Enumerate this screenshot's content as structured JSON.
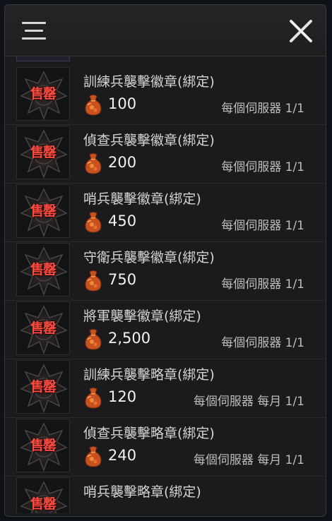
{
  "header": {
    "menu_icon": "menu-icon",
    "close_icon": "close-icon"
  },
  "colors": {
    "panel_bg": "#1b1b1d",
    "badge_label": "#ff4a40",
    "coin": "#e0622a",
    "text_main": "#d4d4d4",
    "text_sub": "#bdbdbd"
  },
  "items": [
    {
      "title": "訓練兵襲擊徽章(綁定)",
      "price": "100",
      "limit": "每個伺服器 1/1",
      "badge": "售罄"
    },
    {
      "title": "偵查兵襲擊徽章(綁定)",
      "price": "200",
      "limit": "每個伺服器 1/1",
      "badge": "售罄"
    },
    {
      "title": "哨兵襲擊徽章(綁定)",
      "price": "450",
      "limit": "每個伺服器 1/1",
      "badge": "售罄"
    },
    {
      "title": "守衛兵襲擊徽章(綁定)",
      "price": "750",
      "limit": "每個伺服器 1/1",
      "badge": "售罄"
    },
    {
      "title": "將軍襲擊徽章(綁定)",
      "price": "2,500",
      "limit": "每個伺服器 1/1",
      "badge": "售罄"
    },
    {
      "title": "訓練兵襲擊略章(綁定)",
      "price": "120",
      "limit": "每個伺服器 每月 1/1",
      "badge": "售罄"
    },
    {
      "title": "偵查兵襲擊略章(綁定)",
      "price": "240",
      "limit": "每個伺服器 每月 1/1",
      "badge": "售罄"
    },
    {
      "title": "哨兵襲擊略章(綁定)",
      "price": "",
      "limit": "",
      "badge": "售罄"
    }
  ]
}
